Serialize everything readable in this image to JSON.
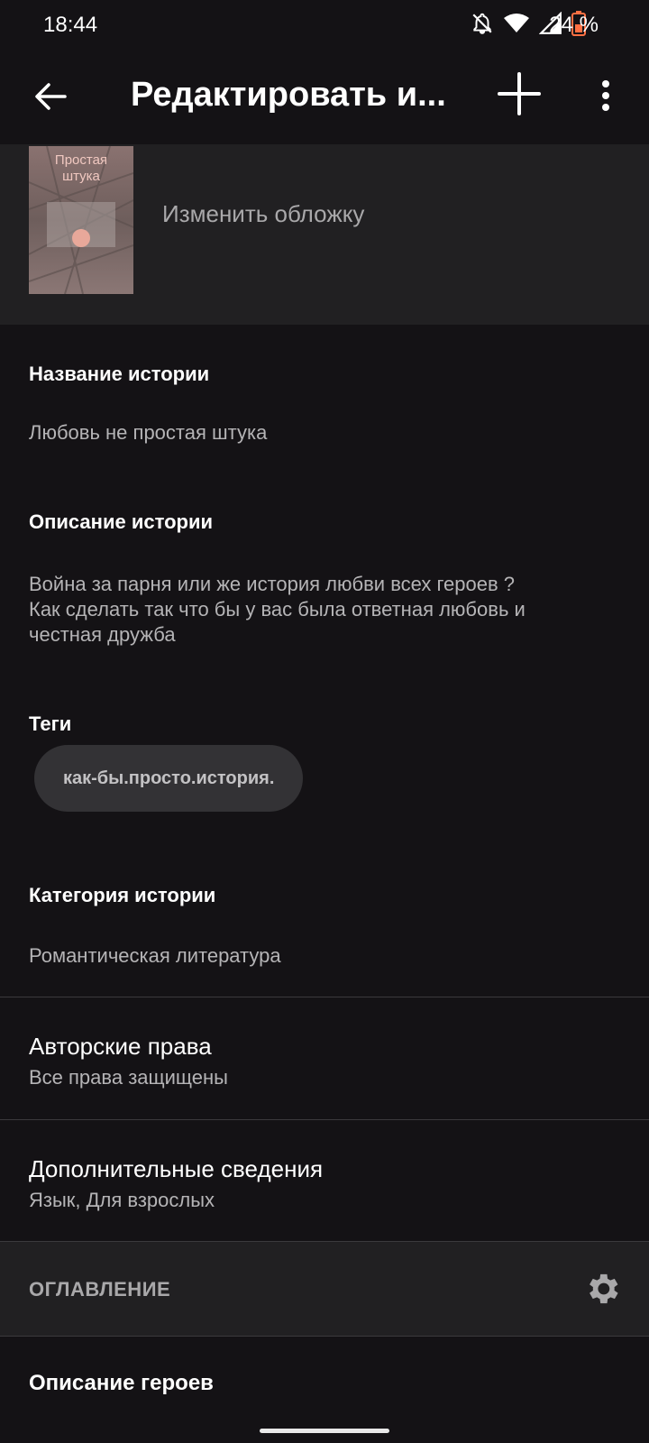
{
  "status_bar": {
    "time": "18:44",
    "battery_percent": "24 %",
    "icons": [
      "bell-off-icon",
      "wifi-icon",
      "signal-icon",
      "battery-icon"
    ],
    "battery_color": "#ff7043"
  },
  "app_bar": {
    "title": "Редактировать и...",
    "icons": [
      "back-arrow-icon",
      "add-icon",
      "more-vert-icon"
    ]
  },
  "cover": {
    "thumb_text": "Простая\nштука",
    "change_label": "Изменить обложку"
  },
  "story": {
    "title_label": "Название истории",
    "title_value": "Любовь не простая штука",
    "description_label": "Описание истории",
    "description_value": "Война за парня или же история любви всех героев ?\nКак сделать так что бы у вас была ответная любовь и\nчестная дружба",
    "tags_label": "Теги",
    "tags": [
      "как-бы.просто.история."
    ],
    "category_label": "Категория истории",
    "category_value": "Романтическая литература"
  },
  "rows": {
    "copyright_title": "Авторские права",
    "copyright_value": "Все права защищены",
    "extra_title": "Дополнительные сведения",
    "extra_value": "Язык, Для взрослых"
  },
  "toc": {
    "header": "ОГЛАВЛЕНИЕ",
    "gear_icon": "gear-icon",
    "chapters": [
      "Описание героев"
    ]
  },
  "colors": {
    "background": "#141215",
    "panel": "#212022",
    "chip": "#333235"
  }
}
